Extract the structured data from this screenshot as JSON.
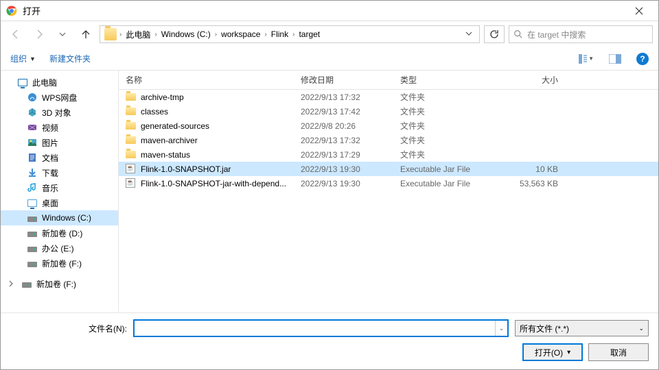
{
  "window": {
    "title": "打开"
  },
  "breadcrumbs": [
    "此电脑",
    "Windows  (C:)",
    "workspace",
    "Flink",
    "target"
  ],
  "search": {
    "placeholder": "在 target 中搜索"
  },
  "toolbar": {
    "organize": "组织",
    "newfolder": "新建文件夹"
  },
  "sidebar": {
    "root": "此电脑",
    "items": [
      {
        "label": "WPS网盘",
        "icon": "wps"
      },
      {
        "label": "3D 对象",
        "icon": "3d"
      },
      {
        "label": "视频",
        "icon": "video"
      },
      {
        "label": "图片",
        "icon": "picture"
      },
      {
        "label": "文档",
        "icon": "doc"
      },
      {
        "label": "下载",
        "icon": "download"
      },
      {
        "label": "音乐",
        "icon": "music"
      },
      {
        "label": "桌面",
        "icon": "desktop"
      },
      {
        "label": "Windows  (C:)",
        "icon": "drive",
        "selected": true
      },
      {
        "label": "新加卷 (D:)",
        "icon": "drive"
      },
      {
        "label": "办公 (E:)",
        "icon": "drive"
      },
      {
        "label": "新加卷 (F:)",
        "icon": "drive"
      }
    ],
    "bottom": "新加卷 (F:)"
  },
  "columns": {
    "name": "名称",
    "date": "修改日期",
    "type": "类型",
    "size": "大小"
  },
  "files": [
    {
      "name": "archive-tmp",
      "date": "2022/9/13 17:32",
      "type": "文件夹",
      "size": "",
      "kind": "folder"
    },
    {
      "name": "classes",
      "date": "2022/9/13 17:42",
      "type": "文件夹",
      "size": "",
      "kind": "folder"
    },
    {
      "name": "generated-sources",
      "date": "2022/9/8 20:26",
      "type": "文件夹",
      "size": "",
      "kind": "folder"
    },
    {
      "name": "maven-archiver",
      "date": "2022/9/13 17:32",
      "type": "文件夹",
      "size": "",
      "kind": "folder"
    },
    {
      "name": "maven-status",
      "date": "2022/9/13 17:29",
      "type": "文件夹",
      "size": "",
      "kind": "folder"
    },
    {
      "name": "Flink-1.0-SNAPSHOT.jar",
      "date": "2022/9/13 19:30",
      "type": "Executable Jar File",
      "size": "10 KB",
      "kind": "jar",
      "selected": true
    },
    {
      "name": "Flink-1.0-SNAPSHOT-jar-with-depend...",
      "date": "2022/9/13 19:30",
      "type": "Executable Jar File",
      "size": "53,563 KB",
      "kind": "jar"
    }
  ],
  "footer": {
    "filename_label": "文件名(N):",
    "filter": "所有文件 (*.*)",
    "open": "打开(O)",
    "cancel": "取消"
  }
}
